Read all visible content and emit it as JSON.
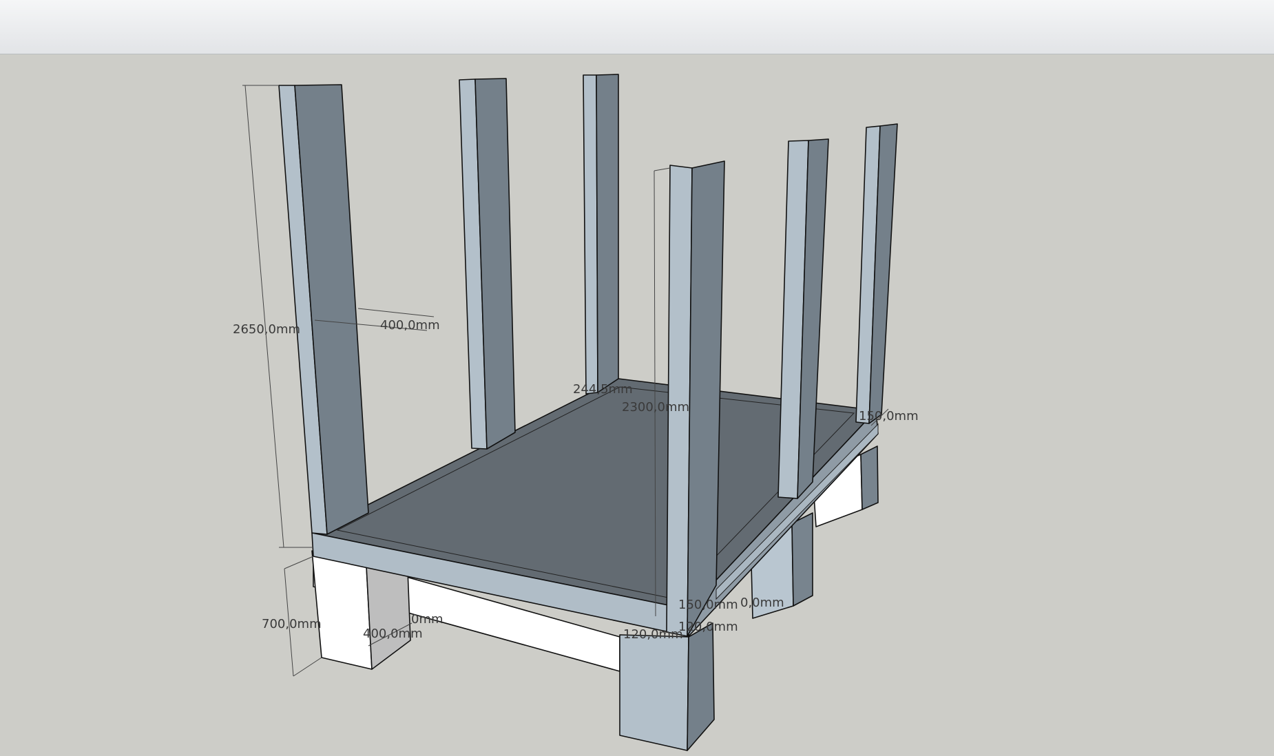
{
  "window": {
    "toolbar_area": ""
  },
  "model": {
    "colors": {
      "column_light": "#b3c0ca",
      "column_dark": "#74808a",
      "slab_top": "#636b72",
      "slab_edge": "#b0bdc7",
      "beam_front": "#ffffff",
      "beam_shadow": "#bcbcbc",
      "background": "#cdcdc8"
    }
  },
  "dimensions": {
    "column_height": "2650,0mm",
    "column_width": "400,0mm",
    "inner_height": "2300,0mm",
    "offset_a": "244,5mm",
    "side_right": "150,0mm",
    "beam_height": "700,0mm",
    "beam_width": "400,0mm",
    "beam_partial": "0mm",
    "slab_a": "150,0mm",
    "slab_b": "0,0mm",
    "slab_c": "120,0mm",
    "slab_d": "120,0mm"
  }
}
